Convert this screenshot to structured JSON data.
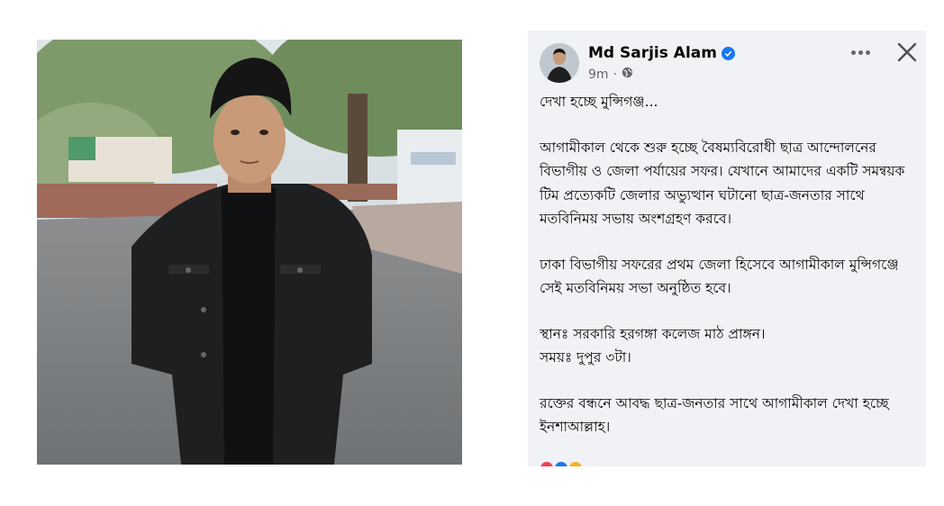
{
  "post": {
    "author": "Md Sarjis Alam",
    "time": "9m",
    "time_separator": "·",
    "privacy_icon": "globe-icon",
    "more_icon": "more-options-icon",
    "close_icon": "close-icon",
    "paragraphs": [
      "দেখা হচ্ছে মুন্সিগঞ্জ...",
      "আগামীকাল থেকে শুরু হচ্ছে বৈষম্যবিরোধী ছাত্র আন্দোলনের বিভাগীয় ও জেলা পর্যায়ের সফর। যেখানে আমাদের একটি সমন্বয়ক টিম প্রত্যেকটি জেলার অভ্যুত্থান ঘটানো ছাত্র-জনতার সাথে মতবিনিময় সভায় অংশগ্রহণ করবে।",
      "ঢাকা বিভাগীয় সফরের প্রথম জেলা হিসেবে আগামীকাল মুন্সিগঞ্জে সেই মতবিনিময় সভা অনুষ্ঠিত হবে।",
      "স্থানঃ সরকারি হরগঙ্গা কলেজ মাঠ প্রাঙ্গন।\nসময়ঃ দুপুর ৩টা।",
      "রক্তের বন্ধনে আবদ্ধ ছাত্র-জনতার সাথে আগামীকাল দেখা হচ্ছে ইনশাআল্লাহ।"
    ]
  },
  "colors": {
    "card_bg": "#f0f2f5",
    "verified": "#1877f2",
    "meta_text": "#65676b"
  }
}
